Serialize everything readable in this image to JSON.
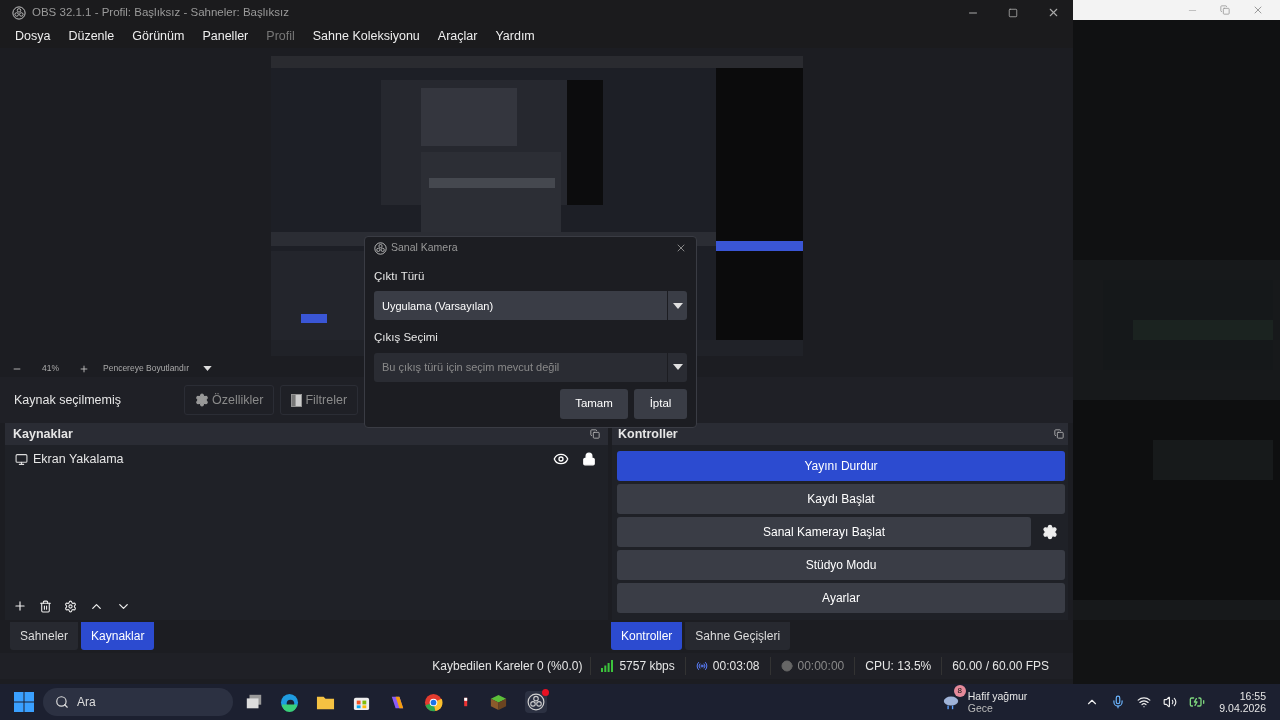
{
  "window": {
    "title": "OBS 32.1.1 - Profil: Başlıksız - Sahneler: Başlıksız"
  },
  "menu": [
    {
      "label": "Dosya",
      "disabled": false
    },
    {
      "label": "Düzenle",
      "disabled": false
    },
    {
      "label": "Görünüm",
      "disabled": false
    },
    {
      "label": "Paneller",
      "disabled": false
    },
    {
      "label": "Profil",
      "disabled": true
    },
    {
      "label": "Sahne Koleksiyonu",
      "disabled": false
    },
    {
      "label": "Araçlar",
      "disabled": false
    },
    {
      "label": "Yardım",
      "disabled": false
    }
  ],
  "zoom_bar": {
    "zoom": "41%",
    "fit": "Pencereye Boyutlandır"
  },
  "source_toolbar": {
    "status": "Kaynak seçilmemiş",
    "buttons": [
      {
        "kind": "properties",
        "label": "Özellikler",
        "disabled": true
      },
      {
        "kind": "filters",
        "label": "Filtreler",
        "disabled": true
      }
    ]
  },
  "sources_dock": {
    "title": "Kaynaklar",
    "items": [
      {
        "name": "Ekran Yakalama",
        "visible": true,
        "locked": true
      }
    ]
  },
  "controls_dock": {
    "title": "Kontroller",
    "buttons": [
      {
        "label": "Yayını Durdur",
        "active": true,
        "has_settings": false
      },
      {
        "label": "Kaydı Başlat",
        "active": false,
        "has_settings": false
      },
      {
        "label": "Sanal Kamerayı Başlat",
        "active": false,
        "has_settings": true
      },
      {
        "label": "Stüdyo Modu",
        "active": false,
        "has_settings": false
      },
      {
        "label": "Ayarlar",
        "active": false,
        "has_settings": false
      }
    ]
  },
  "left_tabs": [
    {
      "label": "Sahneler",
      "selected": false
    },
    {
      "label": "Kaynaklar",
      "selected": true
    }
  ],
  "right_tabs": [
    {
      "label": "Kontroller",
      "selected": true
    },
    {
      "label": "Sahne Geçişleri",
      "selected": false
    }
  ],
  "status_bar": {
    "dropped_frames": "Kaybedilen Kareler 0 (%0.0)",
    "bitrate": "5757 kbps",
    "stream_time": "00:03:08",
    "record_time": "00:00:00",
    "cpu": "CPU: 13.5%",
    "fps": "60.00 / 60.00 FPS"
  },
  "dialog": {
    "title": "Sanal Kamera",
    "fields": [
      {
        "label": "Çıktı Türü",
        "value": "Uygulama (Varsayılan)",
        "disabled": false
      },
      {
        "label": "Çıkış Seçimi",
        "value": "Bu çıkış türü için seçim mevcut değil",
        "disabled": true
      }
    ],
    "buttons": [
      "Tamam",
      "İptal"
    ]
  },
  "taskbar": {
    "search_placeholder": "Ara",
    "weather": {
      "badge": "8",
      "title": "Hafif yağmur",
      "subtitle": "Gece"
    },
    "time": "16:55",
    "date": "9.04.2026"
  }
}
